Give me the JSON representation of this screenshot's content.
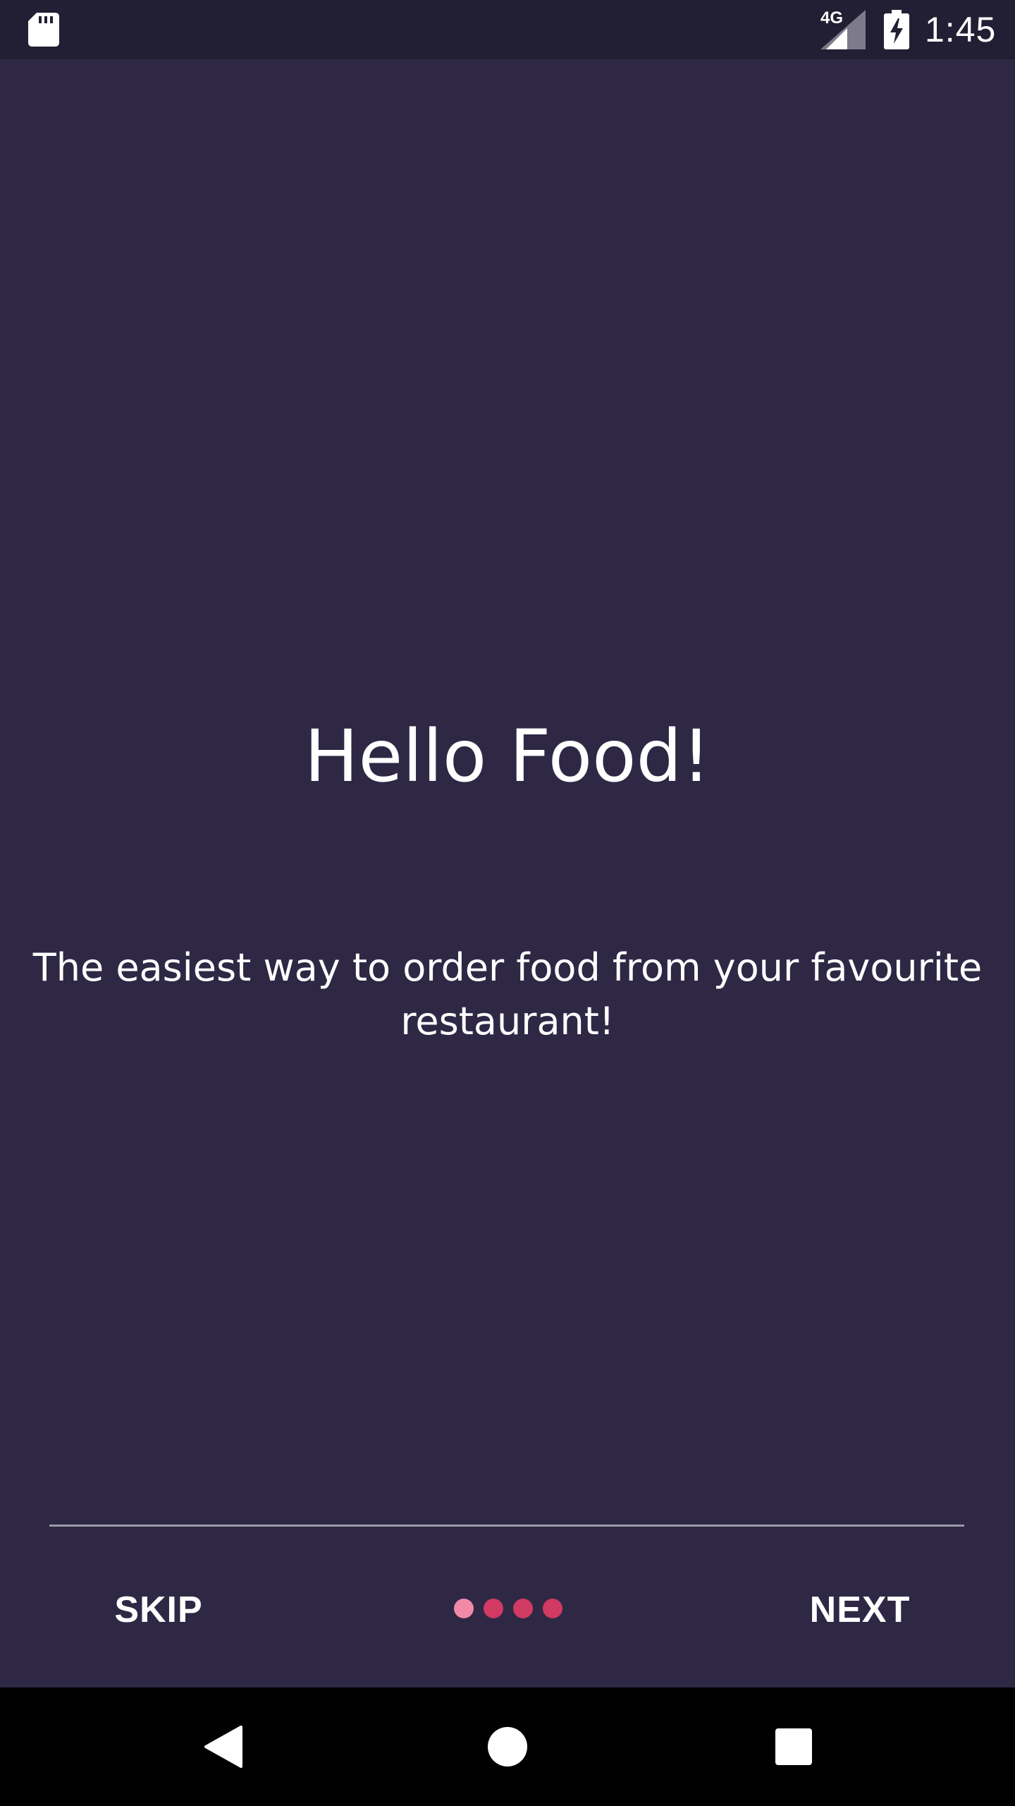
{
  "status_bar": {
    "network": "4G",
    "time": "1:45",
    "icons": [
      "sd-card-icon",
      "signal-icon",
      "battery-charging-icon"
    ]
  },
  "onboarding": {
    "title": "Hello Food!",
    "subtitle": "The easiest way to order food from your favourite restaurant!",
    "skip_label": "SKIP",
    "next_label": "NEXT",
    "page_count": 4,
    "current_page": 1
  },
  "nav_bar": {
    "icons": [
      "back-icon",
      "home-icon",
      "recents-icon"
    ]
  },
  "colors": {
    "background": "#2e2845",
    "status_bar": "#221e33",
    "dot": "#d03a63",
    "dot_active": "#f08aa8",
    "divider": "#9a97a8",
    "text": "#ffffff",
    "nav_bar": "#000000"
  }
}
